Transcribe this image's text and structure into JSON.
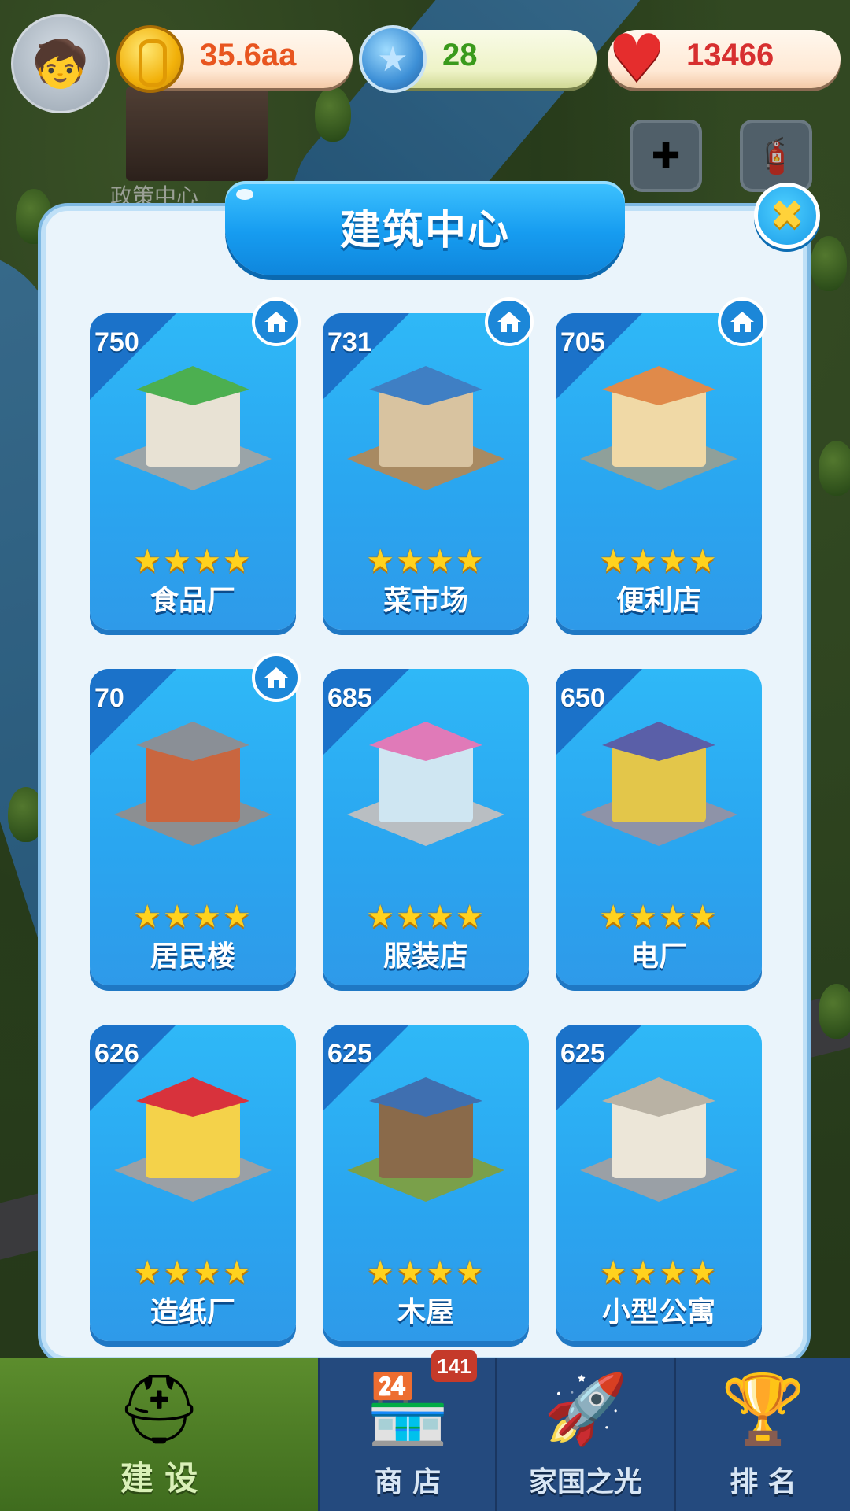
{
  "top_bar": {
    "coins": {
      "value": "35.6aa",
      "icon": "coin-icon",
      "color": "#e8551f"
    },
    "gems": {
      "value": "28",
      "icon": "blue-star-gem-icon",
      "color": "#3a9a1c"
    },
    "hearts": {
      "value": "13466",
      "icon": "heart-icon",
      "color": "#d72f2f"
    }
  },
  "background": {
    "policy_center_label": "政策中心"
  },
  "panel": {
    "title": "建筑中心",
    "close_icon": "close-icon"
  },
  "buildings": [
    {
      "name": "食品厂",
      "value": "750",
      "stars": "★★★★",
      "star_count": 4,
      "home_marker": true
    },
    {
      "name": "菜市场",
      "value": "731",
      "stars": "★★★★",
      "star_count": 4,
      "home_marker": true
    },
    {
      "name": "便利店",
      "value": "705",
      "stars": "★★★★",
      "star_count": 4,
      "home_marker": true
    },
    {
      "name": "居民楼",
      "value": "70",
      "stars": "★★★★",
      "star_count": 4,
      "home_marker": true
    },
    {
      "name": "服装店",
      "value": "685",
      "stars": "★★★★",
      "star_count": 4,
      "home_marker": false
    },
    {
      "name": "电厂",
      "value": "650",
      "stars": "★★★★",
      "star_count": 4,
      "home_marker": false
    },
    {
      "name": "造纸厂",
      "value": "626",
      "stars": "★★★★",
      "star_count": 4,
      "home_marker": false
    },
    {
      "name": "木屋",
      "value": "625",
      "stars": "★★★★",
      "star_count": 4,
      "home_marker": false
    },
    {
      "name": "小型公寓",
      "value": "625",
      "stars": "★★★★",
      "star_count": 4,
      "home_marker": false
    }
  ],
  "bottom_nav": {
    "badge": "141",
    "tabs": [
      {
        "label": "建 设",
        "icon": "hard-hat-icon",
        "active": true
      },
      {
        "label": "商 店",
        "icon": "shop-icon",
        "active": false
      },
      {
        "label": "家国之光",
        "icon": "rocket-icon",
        "active": false
      },
      {
        "label": "排 名",
        "icon": "ranking-podium-icon",
        "active": false
      }
    ]
  }
}
